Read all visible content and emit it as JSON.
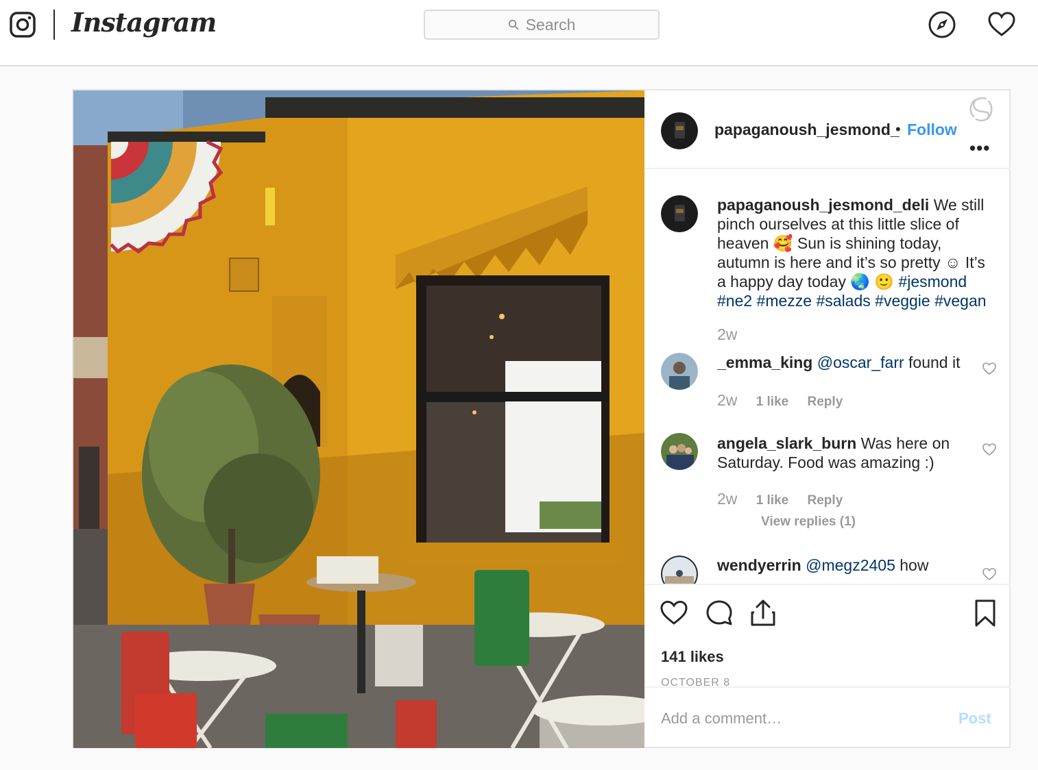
{
  "nav": {
    "logo_text": "Instagram",
    "search_placeholder": "Search",
    "icons": [
      "instagram-glyph-icon",
      "search-icon",
      "compass-icon",
      "heart-icon"
    ]
  },
  "post": {
    "username": "papaganoush_jesmond_",
    "dot": "•",
    "follow_label": "Follow",
    "more_label": "•••",
    "caption": {
      "username": "papaganoush_jesmond_deli",
      "line1": "We still",
      "line2": "pinch ourselves at this little slice of",
      "line3_a": "heaven",
      "line3_emoji": "🥰",
      "line3_b": "Sun is shining today,",
      "line4": "autumn is here and it’s so pretty ☺ It’s",
      "line5_a": "a happy day today",
      "line5_emoji": "🌏 🙂",
      "line5_tag": "#jesmond",
      "line6": "#ne2 #mezze #salads #veggie #vegan",
      "time": "2w"
    },
    "comments": [
      {
        "username": "_emma_king",
        "mention": "@oscar_farr",
        "text": "found it",
        "time": "2w",
        "likes": "1 like",
        "reply": "Reply"
      },
      {
        "username": "angela_slark_burn",
        "text_line1": "Was here on",
        "text_line2": "Saturday. Food was amazing :)",
        "time": "2w",
        "likes": "1 like",
        "reply": "Reply",
        "view_replies": "View replies (1)"
      },
      {
        "username": "wendyerrin",
        "mention": "@megz2405",
        "text": "how"
      }
    ],
    "likes_count": "141 likes",
    "date": "OCTOBER 8",
    "add_comment_placeholder": "Add a comment…",
    "post_label": "Post",
    "colors": {
      "link_blue": "#3897f0",
      "hashtag_navy": "#003569",
      "wall_yellow": "#e6a91c",
      "muted_gray": "#999999"
    }
  }
}
